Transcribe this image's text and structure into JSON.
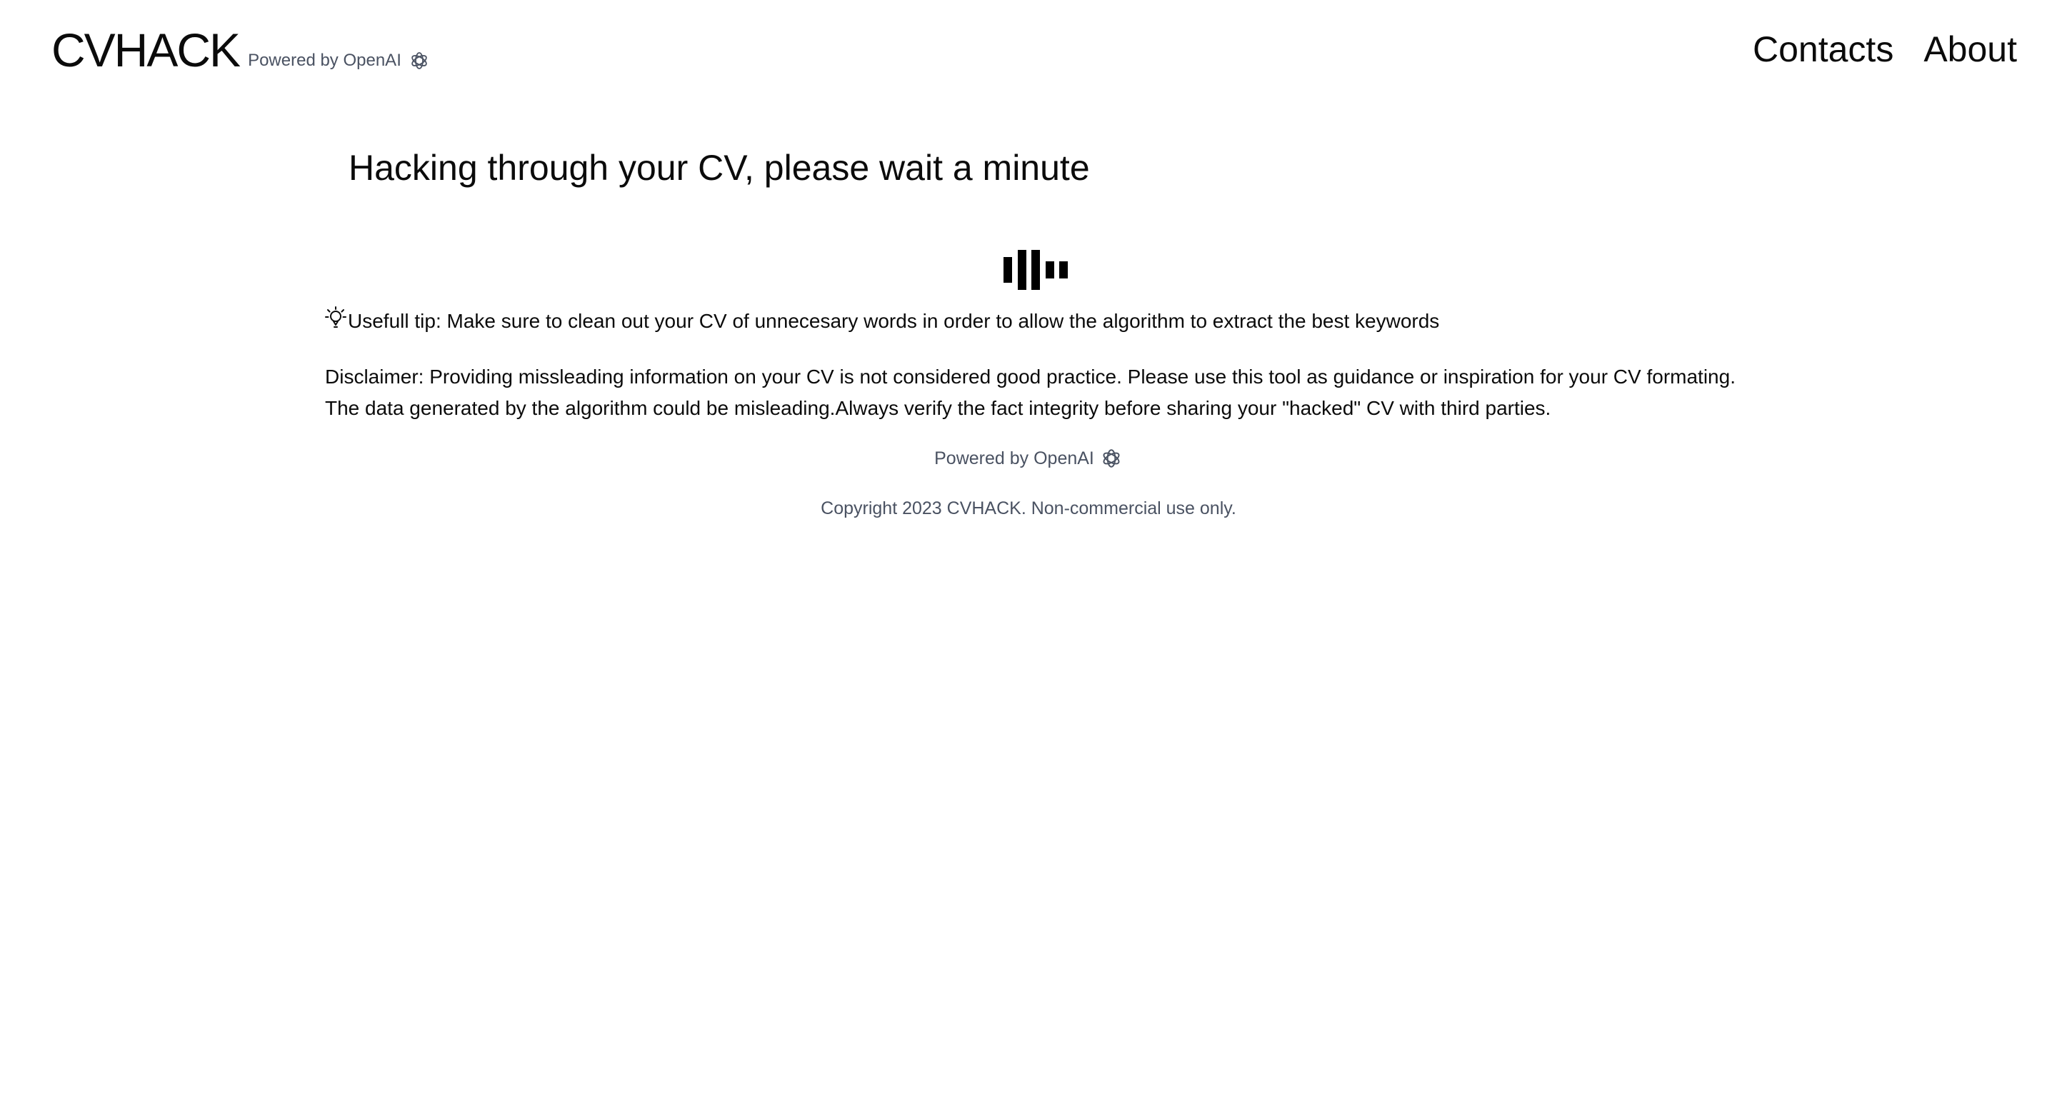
{
  "header": {
    "brand": "CVHACK",
    "powered_by": "Powered by OpenAI",
    "nav": {
      "contacts": "Contacts",
      "about": "About"
    }
  },
  "main": {
    "title": "Hacking through your CV, please wait a minute",
    "loader_icon": "audio-bars-loader-icon",
    "tip": "Usefull tip: Make sure to clean out your CV of unnecesary words in order to allow the algorithm to extract the best keywords",
    "tip_icon": "lightbulb-icon",
    "disclaimer": "Disclaimer: Providing missleading information on your CV is not considered good practice. Please use this tool as guidance or inspiration for your CV formating. The data generated by the algorithm could be misleading.Always verify the fact integrity before sharing your \"hacked\" CV with third parties."
  },
  "footer": {
    "powered_by": "Powered by OpenAI",
    "openai_icon": "openai-logo-icon",
    "copyright": "Copyright 2023 CVHACK. Non-commercial use only."
  },
  "colors": {
    "text": "#0b0b0b",
    "muted": "#4a5262",
    "background": "#ffffff"
  }
}
